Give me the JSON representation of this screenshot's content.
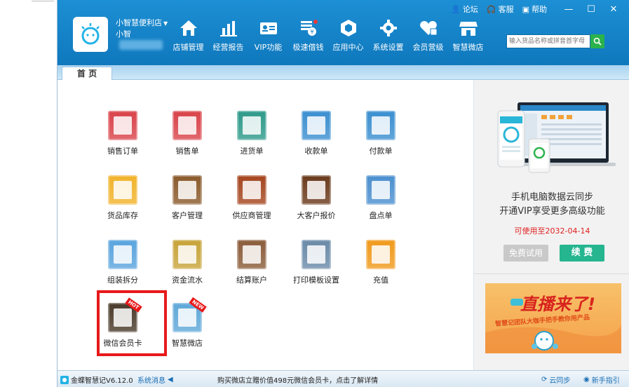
{
  "window": {
    "links": [
      {
        "icon": "user-icon",
        "label": "论坛"
      },
      {
        "icon": "headset-icon",
        "label": "客服"
      },
      {
        "icon": "help-icon",
        "label": "帮助"
      }
    ],
    "controls": {
      "minimize": "—",
      "maximize": "☐",
      "close": "✕"
    }
  },
  "shop": {
    "name": "小智慧便利店",
    "user": "小智"
  },
  "nav": [
    {
      "icon": "home-icon",
      "label": "店铺管理"
    },
    {
      "icon": "bar-chart-icon",
      "label": "经营报告"
    },
    {
      "icon": "vip-card-icon",
      "label": "VIP功能"
    },
    {
      "icon": "loan-icon",
      "label": "极速借钱"
    },
    {
      "icon": "app-center-icon",
      "label": "应用中心"
    },
    {
      "icon": "gear-icon",
      "label": "系统设置"
    },
    {
      "icon": "heart-icon",
      "label": "会员营级"
    },
    {
      "icon": "store-icon",
      "label": "智慧微店"
    }
  ],
  "search": {
    "placeholder": "输入货品名称或拼音首字母"
  },
  "tabs": [
    {
      "label": "首 页"
    }
  ],
  "grid": [
    {
      "label": "销售订单",
      "icon": "sales-order-icon",
      "color": "#d9434a"
    },
    {
      "label": "销售单",
      "icon": "sales-sheet-icon",
      "color": "#d9434a"
    },
    {
      "label": "进货单",
      "icon": "purchase-sheet-icon",
      "color": "#2e9a8a"
    },
    {
      "label": "收款单",
      "icon": "receipt-icon",
      "color": "#3b8fd0"
    },
    {
      "label": "付款单",
      "icon": "payment-icon",
      "color": "#3b8fd0"
    },
    {
      "label": "货品库存",
      "icon": "inventory-icon",
      "color": "#f1b32b"
    },
    {
      "label": "客户管理",
      "icon": "customer-icon",
      "color": "#8a5a2b"
    },
    {
      "label": "供应商管理",
      "icon": "supplier-icon",
      "color": "#a5461f"
    },
    {
      "label": "大客户报价",
      "icon": "quote-icon",
      "color": "#6a3a1c"
    },
    {
      "label": "盘点单",
      "icon": "stocktake-icon",
      "color": "#4b8fcf"
    },
    {
      "label": "组装拆分",
      "icon": "assembly-icon",
      "color": "#5aa4de"
    },
    {
      "label": "资金流水",
      "icon": "cash-flow-icon",
      "color": "#c7a43a"
    },
    {
      "label": "结算账户",
      "icon": "account-icon",
      "color": "#8a5c3a"
    },
    {
      "label": "打印模板设置",
      "icon": "printer-icon",
      "color": "#6a8aa8"
    },
    {
      "label": "充值",
      "icon": "recharge-icon",
      "color": "#f09a1c"
    },
    {
      "label": "微信会员卡",
      "icon": "wechat-card-icon",
      "color": "#4a3a2a",
      "badge": "HOT"
    },
    {
      "label": "智慧微店",
      "icon": "micro-store-icon",
      "color": "#5fa8d8",
      "badge": "NEW"
    }
  ],
  "promo": {
    "line1": "手机电脑数据云同步",
    "line2": "开通VIP享受更多高级功能",
    "expiry": "可使用至2032-04-14",
    "trial_button": "免费试用",
    "renew_button": "续 费"
  },
  "banner": {
    "headline": "直播来了!",
    "subline": "智慧记团队大咖手把手教你用产品"
  },
  "status": {
    "app": "金蝶智慧记V6.12.0",
    "messages": "系统消息",
    "ticker": "购买微店立赠价值498元微信会员卡，点击了解详情",
    "sync": "云同步",
    "guide": "新手指引"
  }
}
